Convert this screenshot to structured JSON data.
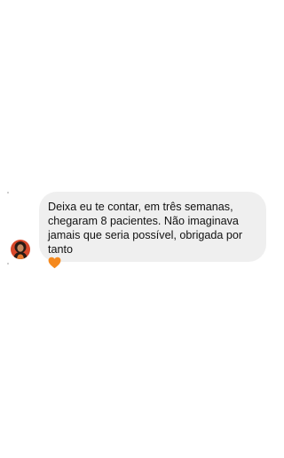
{
  "conversation": {
    "messages": [
      {
        "sender": "received",
        "text": "Deixa eu te contar, em três semanas, chegaram 8 pacientes. Não imaginava jamais que seria possível, obrigada por tanto",
        "emoji": "orange-heart",
        "bubble_color": "#efefef",
        "emoji_color": "#f5891e"
      }
    ]
  }
}
